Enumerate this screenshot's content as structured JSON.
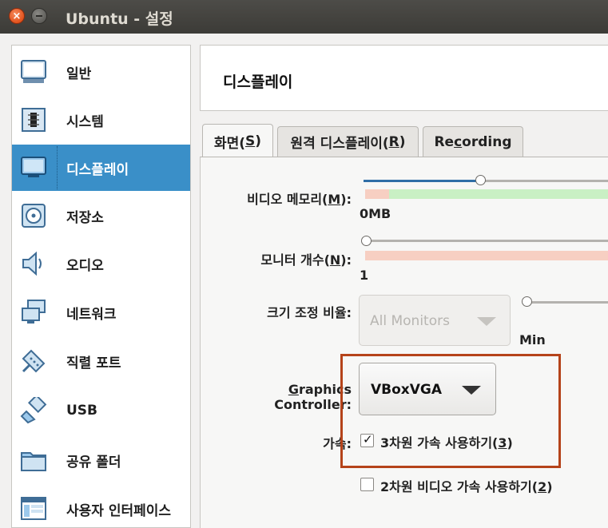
{
  "window": {
    "title": "Ubuntu - 설정"
  },
  "sidebar": {
    "items": [
      {
        "label": "일반",
        "icon": "general-icon"
      },
      {
        "label": "시스템",
        "icon": "system-icon"
      },
      {
        "label": "디스플레이",
        "icon": "display-icon",
        "active": true
      },
      {
        "label": "저장소",
        "icon": "storage-icon"
      },
      {
        "label": "오디오",
        "icon": "audio-icon"
      },
      {
        "label": "네트워크",
        "icon": "network-icon"
      },
      {
        "label": "직렬 포트",
        "icon": "serial-port-icon"
      },
      {
        "label": "USB",
        "icon": "usb-icon"
      },
      {
        "label": "공유 폴더",
        "icon": "shared-folder-icon"
      },
      {
        "label": "사용자 인터페이스",
        "icon": "user-interface-icon"
      }
    ]
  },
  "header": {
    "title": "디스플레이"
  },
  "tabs": [
    {
      "label": "화면(",
      "mnemonic": "S",
      "suffix": ")",
      "active": true
    },
    {
      "label": "원격 디스플레이(",
      "mnemonic": "R",
      "suffix": ")"
    },
    {
      "label": "Re",
      "mnemonic": "c",
      "suffix": "ording"
    }
  ],
  "screen": {
    "video_memory": {
      "label": "비디오 메모리(",
      "mnemonic": "M",
      "suffix": "):",
      "min_label": "0MB"
    },
    "monitor_count": {
      "label": "모니터 개수(",
      "mnemonic": "N",
      "suffix": "):",
      "min_label": "1"
    },
    "scale_factor": {
      "label": "크기 조정 비율:",
      "select_value": "All Monitors",
      "min_label": "Min"
    },
    "graphics_controller": {
      "label_mnemonic": "G",
      "label_rest": "raphics Controller:",
      "value": "VBoxVGA"
    },
    "acceleration": {
      "label": "가속:",
      "enable_3d": {
        "label": "3차원 가속 사용하기(",
        "mnemonic": "3",
        "suffix": ")",
        "checked": true
      },
      "enable_2d": {
        "label": "2차원 비디오 가속 사용하기(",
        "mnemonic": "2",
        "suffix": ")",
        "checked": false
      }
    }
  },
  "colors": {
    "titlebar": "#3c3b37",
    "close_button": "#e2531d",
    "sidebar_active": "#3a8fc8",
    "highlight_box": "#b5431a",
    "slider_fill": "#2f6ea7",
    "band_green": "#c9f0c4",
    "band_red": "#f7cfc2"
  }
}
